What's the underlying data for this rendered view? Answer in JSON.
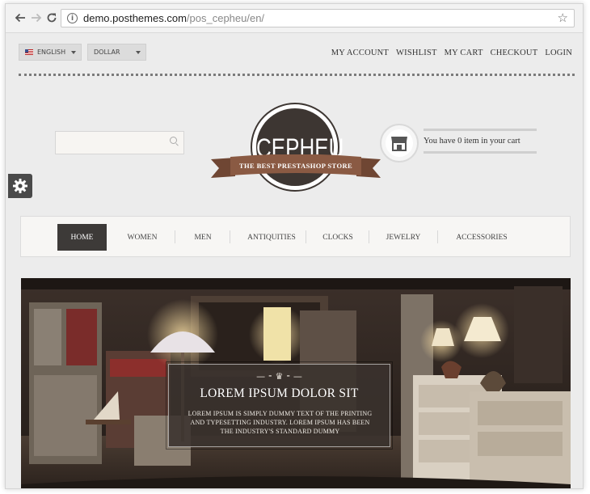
{
  "browser": {
    "url_host": "demo.posthemes.com",
    "url_path": "/pos_cepheu/en/",
    "back_icon": "arrow-left-icon",
    "forward_icon": "arrow-right-icon",
    "reload_icon": "reload-icon",
    "bookmark_icon": "star-icon"
  },
  "header": {
    "language": "ENGLISH",
    "currency": "DOLLAR",
    "links": [
      "MY ACCOUNT",
      "WISHLIST",
      "MY CART",
      "CHECKOUT",
      "LOGIN"
    ]
  },
  "search": {
    "placeholder": ""
  },
  "logo": {
    "name": "CEPHEU",
    "tagline": "THE BEST PRESTASHOP STORE"
  },
  "cart": {
    "text": "You have 0 item in your cart",
    "icon": "shop-icon"
  },
  "menu": {
    "items": [
      "HOME",
      "WOMEN",
      "MEN",
      "ANTIQUITIES",
      "CLOCKS",
      "JEWELRY",
      "ACCESSORIES"
    ],
    "active": "HOME"
  },
  "slider": {
    "title": "LOREM IPSUM DOLOR SIT",
    "description": "LOREM IPSUM IS SIMPLY DUMMY TEXT OF THE PRINTING AND TYPESETTING INDUSTRY. LOREM IPSUM HAS BEEN THE INDUSTRY'S STANDARD DUMMY"
  },
  "colors": {
    "dark": "#3d3632",
    "ribbon": "#8a5a43",
    "background": "#ececec"
  }
}
